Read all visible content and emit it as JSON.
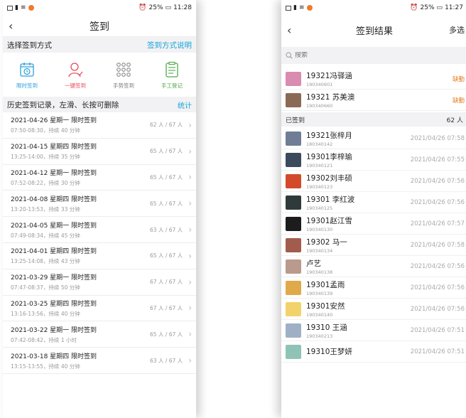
{
  "left": {
    "status": {
      "time": "11:28",
      "battery": "25%"
    },
    "title": "签到",
    "method_section": {
      "label": "选择签到方式",
      "help": "签到方式说明"
    },
    "methods": [
      {
        "label": "限时签到",
        "icon": "clock-calendar-icon",
        "color": "#2b9fd9"
      },
      {
        "label": "一键签到",
        "icon": "person-icon",
        "color": "#e84c57"
      },
      {
        "label": "手势签到",
        "icon": "gesture-grid-icon",
        "color": "#7a7a7a"
      },
      {
        "label": "手工登记",
        "icon": "clipboard-list-icon",
        "color": "#4caa48"
      }
    ],
    "history": {
      "label": "历史签到记录，左滑、长按可删除",
      "stats": "统计"
    },
    "records": [
      {
        "title": "2021-04-26 星期一 限时签到",
        "detail": "07:50-08:30，持续 40 分钟",
        "count": "62 人 / 67 人"
      },
      {
        "title": "2021-04-15 星期四 限时签到",
        "detail": "13:25-14:00，持续 35 分钟",
        "count": "65 人 / 67 人"
      },
      {
        "title": "2021-04-12 星期一 限时签到",
        "detail": "07:52-08:22，持续 30 分钟",
        "count": "65 人 / 67 人"
      },
      {
        "title": "2021-04-08 星期四 限时签到",
        "detail": "13:20-13:53，持续 33 分钟",
        "count": "65 人 / 67 人"
      },
      {
        "title": "2021-04-05 星期一 限时签到",
        "detail": "07:49-08:34，持续 45 分钟",
        "count": "63 人 / 67 人"
      },
      {
        "title": "2021-04-01 星期四 限时签到",
        "detail": "13:25-14:08，持续 43 分钟",
        "count": "65 人 / 67 人"
      },
      {
        "title": "2021-03-29 星期一 限时签到",
        "detail": "07:47-08:37，持续 50 分钟",
        "count": "67 人 / 67 人"
      },
      {
        "title": "2021-03-25 星期四 限时签到",
        "detail": "13:16-13:56，持续 40 分钟",
        "count": "67 人 / 67 人"
      },
      {
        "title": "2021-03-22 星期一 限时签到",
        "detail": "07:42-08:42，持续 1 小时",
        "count": "65 人 / 67 人"
      },
      {
        "title": "2021-03-18 星期四 限时签到",
        "detail": "13:15-13:55，持续 40 分钟",
        "count": "63 人 / 67 人"
      }
    ]
  },
  "right": {
    "status": {
      "time": "11:27",
      "battery": "25%"
    },
    "title": "签到结果",
    "multi_select": "多选",
    "search_placeholder": "搜索",
    "absent": [
      {
        "name": "19321冯驿涵",
        "id": "190340601",
        "status": "缺勤",
        "avatar_color": "#d98bb0"
      },
      {
        "name": "19321 苏美澳",
        "id": "190340660",
        "status": "缺勤",
        "avatar_color": "#8b6a55"
      }
    ],
    "signed_label": "已签到",
    "signed_count": "62 人",
    "signed": [
      {
        "name": "19321张梓月",
        "id": "180340142",
        "time": "2021/04/26 07:58",
        "avatar_color": "#6f7e96"
      },
      {
        "name": "19301李梓瑜",
        "id": "190340121",
        "time": "2021/04/26 07:55",
        "avatar_color": "#3d4a5c"
      },
      {
        "name": "19302刘丰硕",
        "id": "190340123",
        "time": "2021/04/26 07:56",
        "avatar_color": "#d34a2a"
      },
      {
        "name": "19301 李红波",
        "id": "190340125",
        "time": "2021/04/26 07:56",
        "avatar_color": "#2e3b3a"
      },
      {
        "name": "19301赵江雪",
        "id": "190340130",
        "time": "2021/04/26 07:57",
        "avatar_color": "#1c1c1c"
      },
      {
        "name": "19302 马一",
        "id": "190340134",
        "time": "2021/04/26 07:58",
        "avatar_color": "#a25c4e"
      },
      {
        "name": "卢艺",
        "id": "190340138",
        "time": "2021/04/26 07:56",
        "avatar_color": "#b99a8c"
      },
      {
        "name": "19301孟雨",
        "id": "190340139",
        "time": "2021/04/26 07:56",
        "avatar_color": "#e0a94a"
      },
      {
        "name": "19301安然",
        "id": "190340140",
        "time": "2021/04/26 07:56",
        "avatar_color": "#f2d36b"
      },
      {
        "name": "19310 王涵",
        "id": "190340213",
        "time": "2021/04/26 07:51",
        "avatar_color": "#9fb0c4"
      },
      {
        "name": "19310王梦妍",
        "id": "",
        "time": "2021/04/26 07:51",
        "avatar_color": "#8fc3b6"
      }
    ]
  }
}
